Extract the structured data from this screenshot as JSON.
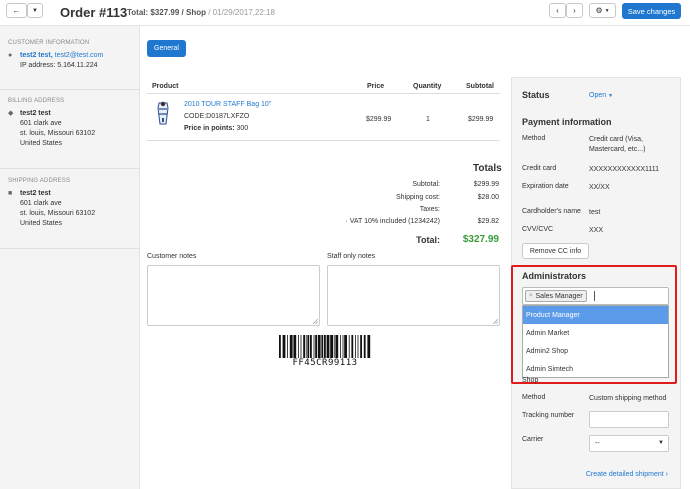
{
  "header": {
    "order_title": "Order #113",
    "total_prefix": "Total: ",
    "total_value": "$327.99 / Shop",
    "date": "/ 01/29/2017,22:18",
    "save_label": "Save changes",
    "back_icon": "arrow-left-icon",
    "dropdown_icon": "caret-down-icon",
    "prev_icon": "chevron-left-icon",
    "next_icon": "chevron-right-icon",
    "settings_icon": "gear-icon"
  },
  "sidebar": {
    "customer": {
      "title": "Customer information",
      "name": "test2 test,",
      "email": "test2@test.com",
      "ip": "IP address: 5.164.11.224"
    },
    "billing": {
      "title": "Billing address",
      "name": "test2 test",
      "line1": "601 clark ave",
      "line2": "st. louis, Missouri 63102",
      "country": "United States"
    },
    "shipping": {
      "title": "Shipping address",
      "name": "test2 test",
      "line1": "601 clark ave",
      "line2": "st. louis, Missouri 63102",
      "country": "United States"
    }
  },
  "main": {
    "tab_general": "General",
    "table": {
      "headers": [
        "Product",
        "Price",
        "Quantity",
        "Subtotal"
      ],
      "rows": [
        {
          "name": "2010 TOUR STAFF Bag 10\"",
          "code": "CODE:D0187LXFZO",
          "points_label": "Price in points:",
          "points_value": "300",
          "price": "$299.99",
          "quantity": "1",
          "subtotal": "$299.99"
        }
      ]
    },
    "totals": {
      "title": "Totals",
      "subtotal_label": "Subtotal:",
      "subtotal_value": "$299.99",
      "shipping_label": "Shipping cost:",
      "shipping_value": "$28.00",
      "taxes_label": "Taxes:",
      "vat_label": "· VAT 10% included (1234242)",
      "vat_value": "$29.82",
      "total_label": "Total:",
      "total_value": "$327.99"
    },
    "customer_notes_label": "Customer notes",
    "staff_notes_label": "Staff only notes",
    "barcode": "FF45CR99113"
  },
  "right_panel": {
    "status_title": "Status",
    "status_value": "Open",
    "payment_title": "Payment information",
    "method_label": "Method",
    "method_value": "Credit card (Visa, Mastercard, etc...)",
    "cc_label": "Credit card",
    "cc_value": "XXXXXXXXXXXX1111",
    "exp_label": "Expiration date",
    "exp_value": "XX/XX",
    "holder_label": "Cardholder's name",
    "holder_value": "test",
    "cvv_label": "CVV/CVC",
    "cvv_value": "XXX",
    "remove_cc": "Remove CC info",
    "admins_title": "Administrators",
    "admin_chip": "Sales Manager",
    "admin_chip_x": "×",
    "admin_options": [
      "Product Manager",
      "Admin Market",
      "Admin2 Shop",
      "Admin Simtech"
    ],
    "shop_label": "Shop",
    "ship_method_label": "Method",
    "ship_method_value": "Custom shipping method",
    "tracking_label": "Tracking number",
    "carrier_label": "Carrier",
    "carrier_value": "--",
    "create_shipment": "Create detailed shipment"
  },
  "colors": {
    "accent": "#1f77d0",
    "highlight": "#e01b1b",
    "total_green": "#3a9d3a",
    "dropdown_active": "#5b9bea"
  }
}
